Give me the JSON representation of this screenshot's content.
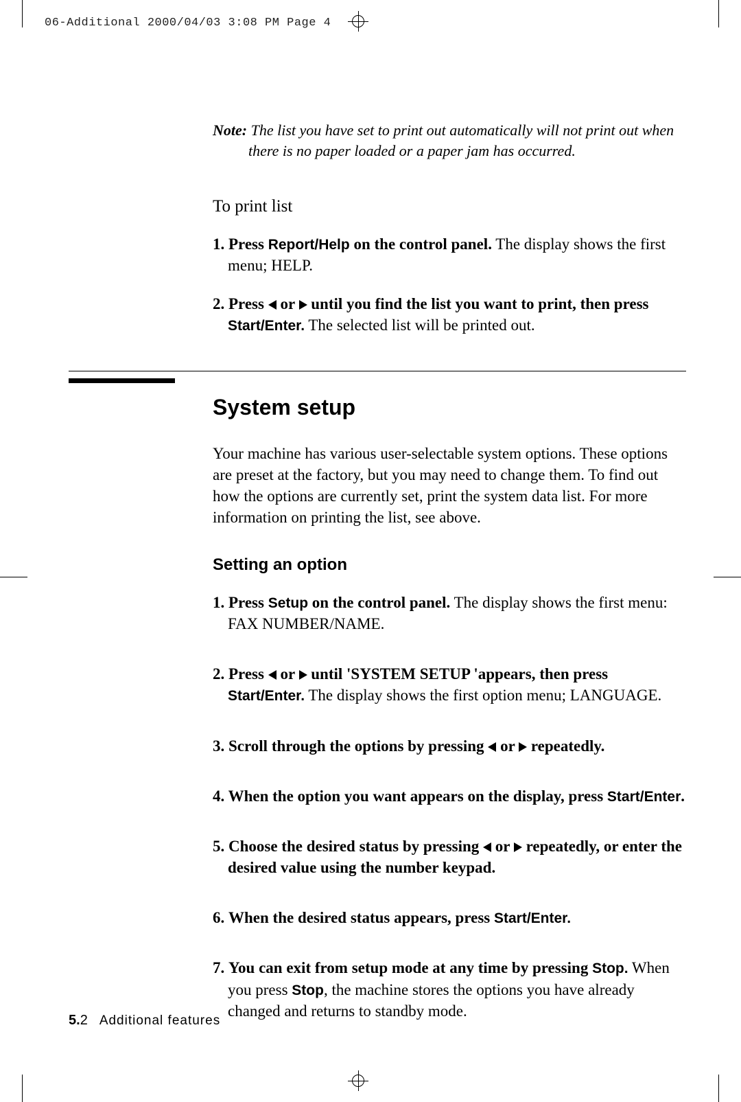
{
  "header": "06-Additional  2000/04/03 3:08 PM  Page 4",
  "note": {
    "label": "Note:",
    "line1": "The list you have set to print out automatically will not print out when",
    "line2": "there is no paper loaded or a paper jam has occurred."
  },
  "to_print_title": "To print list",
  "print_steps": {
    "s1": {
      "num": "1.",
      "lead": "Press ",
      "btn": "Report/Help",
      "mid": " on the control panel.",
      "tail": " The display shows the first menu; HELP."
    },
    "s2": {
      "num": "2.",
      "lead": "Press ",
      "mid": " or ",
      "tail_bold": " until you find the list you want to print, then press ",
      "btn": "Start/Enter.",
      "after": " The selected list will be printed out."
    }
  },
  "section_heading": "System setup",
  "intro_para": "Your machine has various user-selectable system options. These options are preset at the factory, but you may need to change them. To find out how the options are currently set, print the system data list. For more  information on printing the list, see above.",
  "subhead": "Setting an option",
  "setting_steps": {
    "s1": {
      "num": "1.",
      "lead": " Press ",
      "btn": "Setup",
      "mid": " on the control panel.",
      "tail": " The display shows the first menu: FAX NUMBER/NAME."
    },
    "s2": {
      "num": "2.",
      "lead": " Press ",
      "or": " or ",
      "mid": " until 'SYSTEM SETUP 'appears, then press ",
      "btn": "Start/Enter.",
      "tail": " The display shows the first option menu;  LANGUAGE."
    },
    "s3": {
      "num": "3.",
      "lead": "Scroll through the options by pressing ",
      "or": " or ",
      "tail": " repeatedly."
    },
    "s4": {
      "num": "4.",
      "lead": " When the option you want appears on the display,  press ",
      "btn": "Start/Enter",
      "tail": "."
    },
    "s5": {
      "num": "5.",
      "lead": " Choose the desired status by pressing ",
      "or": " or ",
      "tail": " repeatedly, or enter the desired value using the number keypad."
    },
    "s6": {
      "num": "6.",
      "lead": "When the desired status appears, press ",
      "btn": "Start/Enter.",
      "tail": ""
    },
    "s7": {
      "num": "7.",
      "lead": "You can exit from setup mode at any time by pressing ",
      "btn": "Stop.",
      "tail1": " When you press ",
      "btn2": "Stop",
      "tail2": ", the machine stores the options you have already changed and returns to standby mode."
    }
  },
  "footer": {
    "chapter": "5.",
    "page": "2",
    "title": "Additional features"
  }
}
